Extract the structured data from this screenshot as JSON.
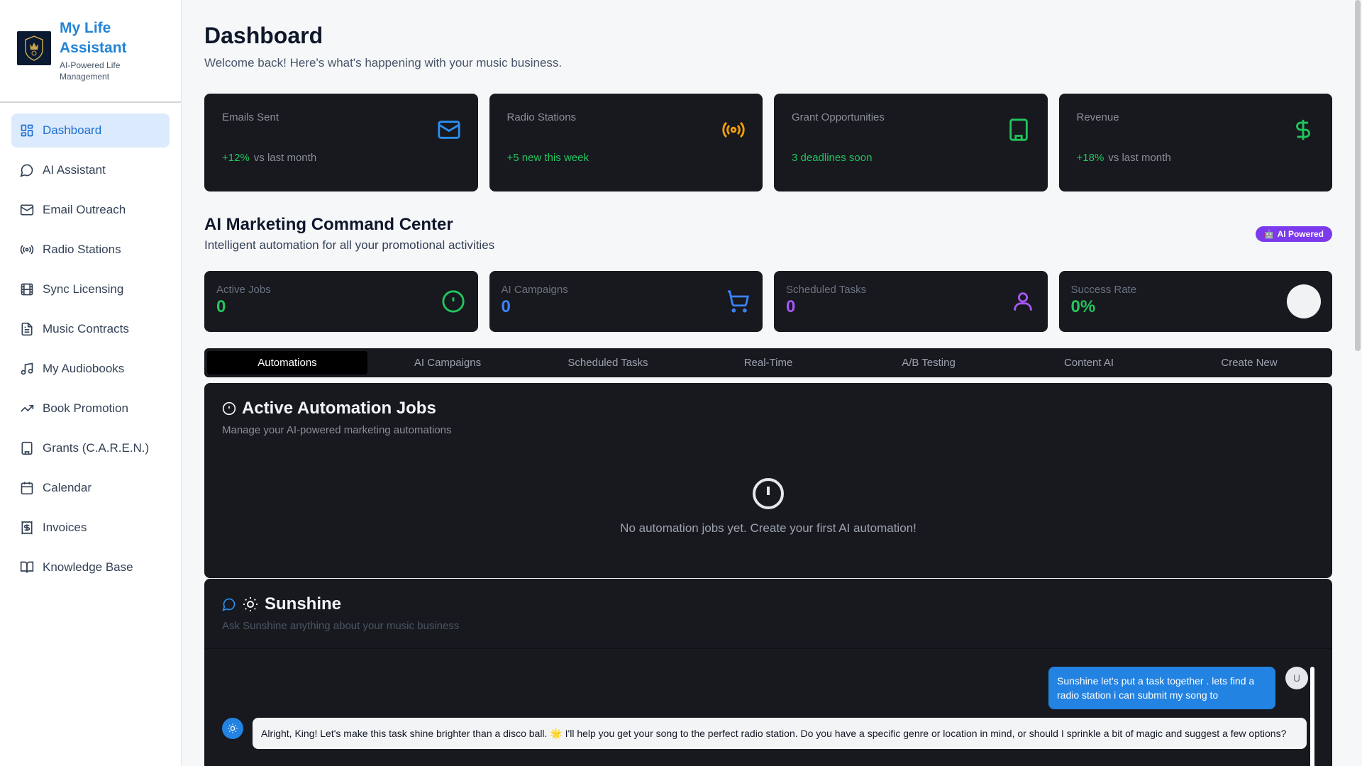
{
  "brand": {
    "title": "My Life Assistant",
    "subtitle": "AI-Powered Life Management",
    "logo_icon": "kingdom-crest-logo"
  },
  "sidebar": {
    "items": [
      {
        "label": "Dashboard",
        "icon": "grid-icon",
        "active": true
      },
      {
        "label": "AI Assistant",
        "icon": "chat-bubble-icon"
      },
      {
        "label": "Email Outreach",
        "icon": "mail-icon"
      },
      {
        "label": "Radio Stations",
        "icon": "radio-icon"
      },
      {
        "label": "Sync Licensing",
        "icon": "film-icon"
      },
      {
        "label": "Music Contracts",
        "icon": "document-icon"
      },
      {
        "label": "My Audiobooks",
        "icon": "music-note-icon"
      },
      {
        "label": "Book Promotion",
        "icon": "trending-up-icon"
      },
      {
        "label": "Grants (C.A.R.E.N.)",
        "icon": "building-icon"
      },
      {
        "label": "Calendar",
        "icon": "calendar-icon"
      },
      {
        "label": "Invoices",
        "icon": "receipt-dollar-icon"
      },
      {
        "label": "Knowledge Base",
        "icon": "book-open-icon"
      }
    ]
  },
  "header": {
    "title": "Dashboard",
    "subtitle": "Welcome back! Here's what's happening with your music business."
  },
  "stats": [
    {
      "label": "Emails Sent",
      "value": "",
      "trend_value": "+12%",
      "trend_text": "vs last month",
      "icon": "mail-icon",
      "color": "#2b8ff0"
    },
    {
      "label": "Radio Stations",
      "value": "",
      "trend_value": "+5 new this week",
      "trend_text": "",
      "icon": "radio-icon",
      "color": "#f59e0b"
    },
    {
      "label": "Grant Opportunities",
      "value": "",
      "trend_value": "3 deadlines soon",
      "trend_text": "",
      "icon": "building-icon",
      "color": "#22c55e"
    },
    {
      "label": "Revenue",
      "value": "",
      "trend_value": "+18%",
      "trend_text": "vs last month",
      "icon": "dollar-icon",
      "color": "#22c55e"
    }
  ],
  "command_center": {
    "title": "AI Marketing Command Center",
    "subtitle": "Intelligent automation for all your promotional activities",
    "badge": "AI Powered",
    "badge_icon": "robot-icon"
  },
  "kpis": [
    {
      "label": "Active Jobs",
      "value": "0",
      "color": "#22c55e",
      "icon": "alert-circle-icon"
    },
    {
      "label": "AI Campaigns",
      "value": "0",
      "color": "#3b82f6",
      "icon": "cart-icon"
    },
    {
      "label": "Scheduled Tasks",
      "value": "0",
      "color": "#a855f7",
      "icon": "user-icon"
    },
    {
      "label": "Success Rate",
      "value": "0%",
      "color": "#22c55e",
      "icon": "circle-indicator"
    }
  ],
  "tabs": [
    {
      "label": "Automations",
      "active": true
    },
    {
      "label": "AI Campaigns"
    },
    {
      "label": "Scheduled Tasks"
    },
    {
      "label": "Real-Time"
    },
    {
      "label": "A/B Testing"
    },
    {
      "label": "Content AI"
    },
    {
      "label": "Create New"
    }
  ],
  "jobs_panel": {
    "title": "Active Automation Jobs",
    "subtitle": "Manage your AI-powered marketing automations",
    "empty_text": "No automation jobs yet. Create your first AI automation!"
  },
  "chat": {
    "title": "Sunshine",
    "subtitle": "Ask Sunshine anything about your music business",
    "user_avatar": "U",
    "messages": [
      {
        "from": "user",
        "text": "Sunshine let's put a task together . lets find a radio station i can submit my song to"
      },
      {
        "from": "bot",
        "text": "Alright, King! Let's make this task shine brighter than a disco ball. 🌟 I'll help you get your song to the perfect radio station. Do you have a specific genre or location in mind, or should I sprinkle a bit of magic and suggest a few options?"
      }
    ]
  }
}
